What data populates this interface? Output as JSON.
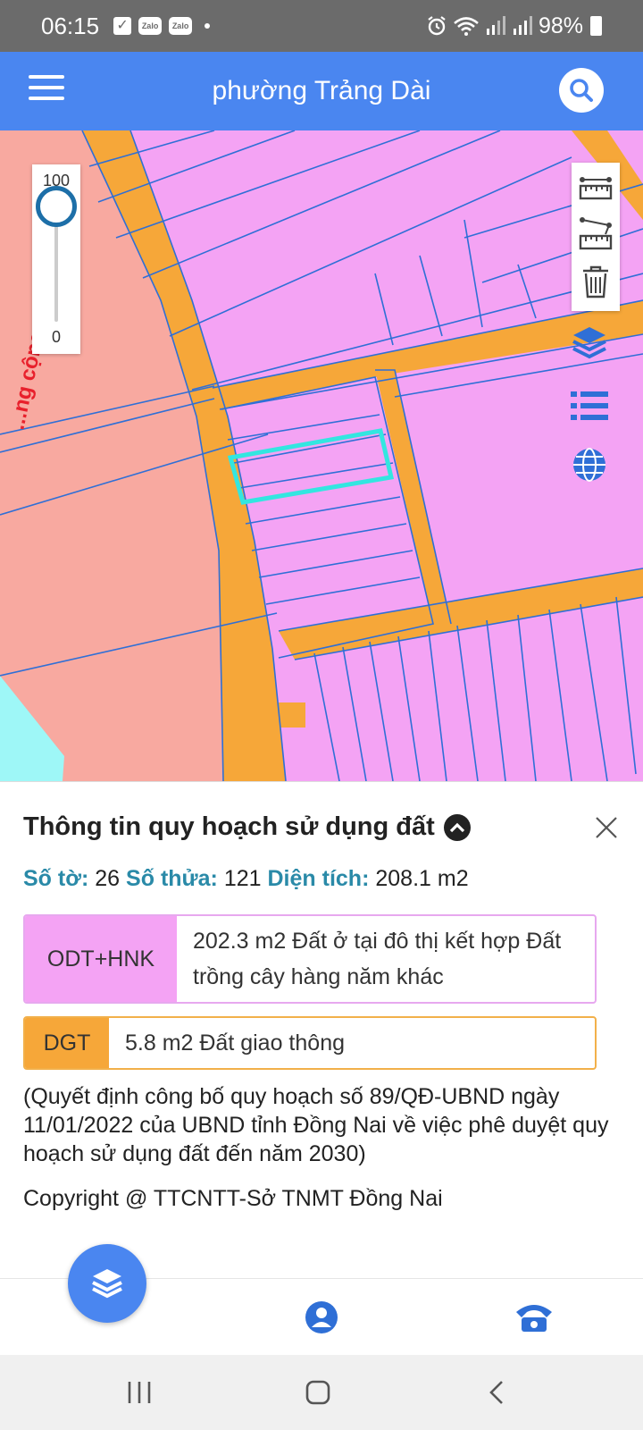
{
  "status_bar": {
    "time": "06:15",
    "notif_check_icon": "check-box-icon",
    "notif_apps": [
      "Zalo",
      "Zalo"
    ],
    "battery": "98%"
  },
  "app_bar": {
    "title": "phường Trảng Dài",
    "menu_icon": "hamburger-menu-icon",
    "search_icon": "search-icon"
  },
  "map": {
    "zoom_slider": {
      "max_label": "100",
      "min_label": "0",
      "value": 100
    },
    "road_label": "...ng cộng",
    "tools": [
      "measure-distance-icon",
      "measure-area-icon",
      "trash-icon"
    ],
    "side_icons": [
      "layers-icon",
      "list-icon",
      "globe-icon"
    ],
    "colors": {
      "residential": "#f4a3f4",
      "road": "#f6a739",
      "public": "#f8a9a0",
      "water": "#9ef7f7",
      "parcel_line": "#2f6fd6",
      "selected": "#33e6e0"
    }
  },
  "panel": {
    "title": "Thông tin quy hoạch sử dụng đất",
    "parcel": {
      "sheet_label": "Số tờ:",
      "sheet_value": "26",
      "lot_label": "Số thửa:",
      "lot_value": "121",
      "area_label": "Diện tích:",
      "area_value": "208.1 m2"
    },
    "land_uses": [
      {
        "code": "ODT+HNK",
        "desc": "202.3 m2 Đất ở tại đô thị kết hợp Đất trồng cây hàng năm khác",
        "color": "#f4a3f4"
      },
      {
        "code": "DGT",
        "desc": "5.8 m2 Đất giao thông",
        "color": "#f6a739"
      }
    ],
    "legal_note": "(Quyết định công bố quy hoạch số 89/QĐ-UBND ngày 11/01/2022 của UBND tỉnh Đồng Nai về việc phê duyệt quy hoạch sử dụng đất đến năm 2030)",
    "copyright": "Copyright @ TTCNTT-Sở TNMT Đồng Nai"
  },
  "bottom_nav": {
    "items": [
      "layers-icon",
      "user-icon",
      "phone-icon"
    ],
    "accent": "#4a86f0"
  }
}
